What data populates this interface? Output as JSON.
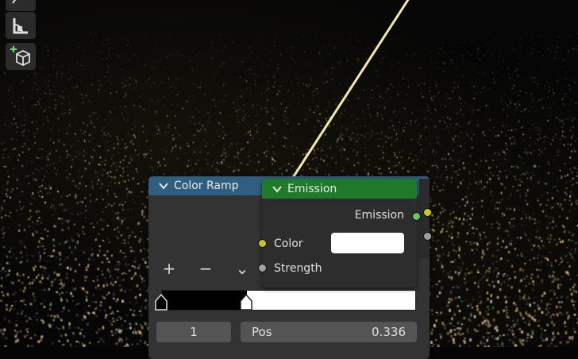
{
  "colors": {
    "color_ramp_header": "#2f5e80",
    "emission_header": "#1f7a2a",
    "socket_yellow": "#c7c72a",
    "socket_grey": "#a0a0a0",
    "socket_green": "#63c763",
    "link_line": "#f3e8a4"
  },
  "toolbar": {
    "icons": [
      "measure-icon",
      "add-cube-icon"
    ]
  },
  "color_ramp_node": {
    "title": "Color Ramp",
    "add_label": "+",
    "remove_label": "−",
    "menu_label": "⌄",
    "active_index": "1",
    "pos_label": "Pos",
    "pos_value": "0.336",
    "stops": [
      0.0,
      0.336
    ]
  },
  "emission_node": {
    "title": "Emission",
    "output_label": "Emission",
    "color_label": "Color",
    "strength_label": "Strength",
    "color_value": "#ffffff"
  }
}
